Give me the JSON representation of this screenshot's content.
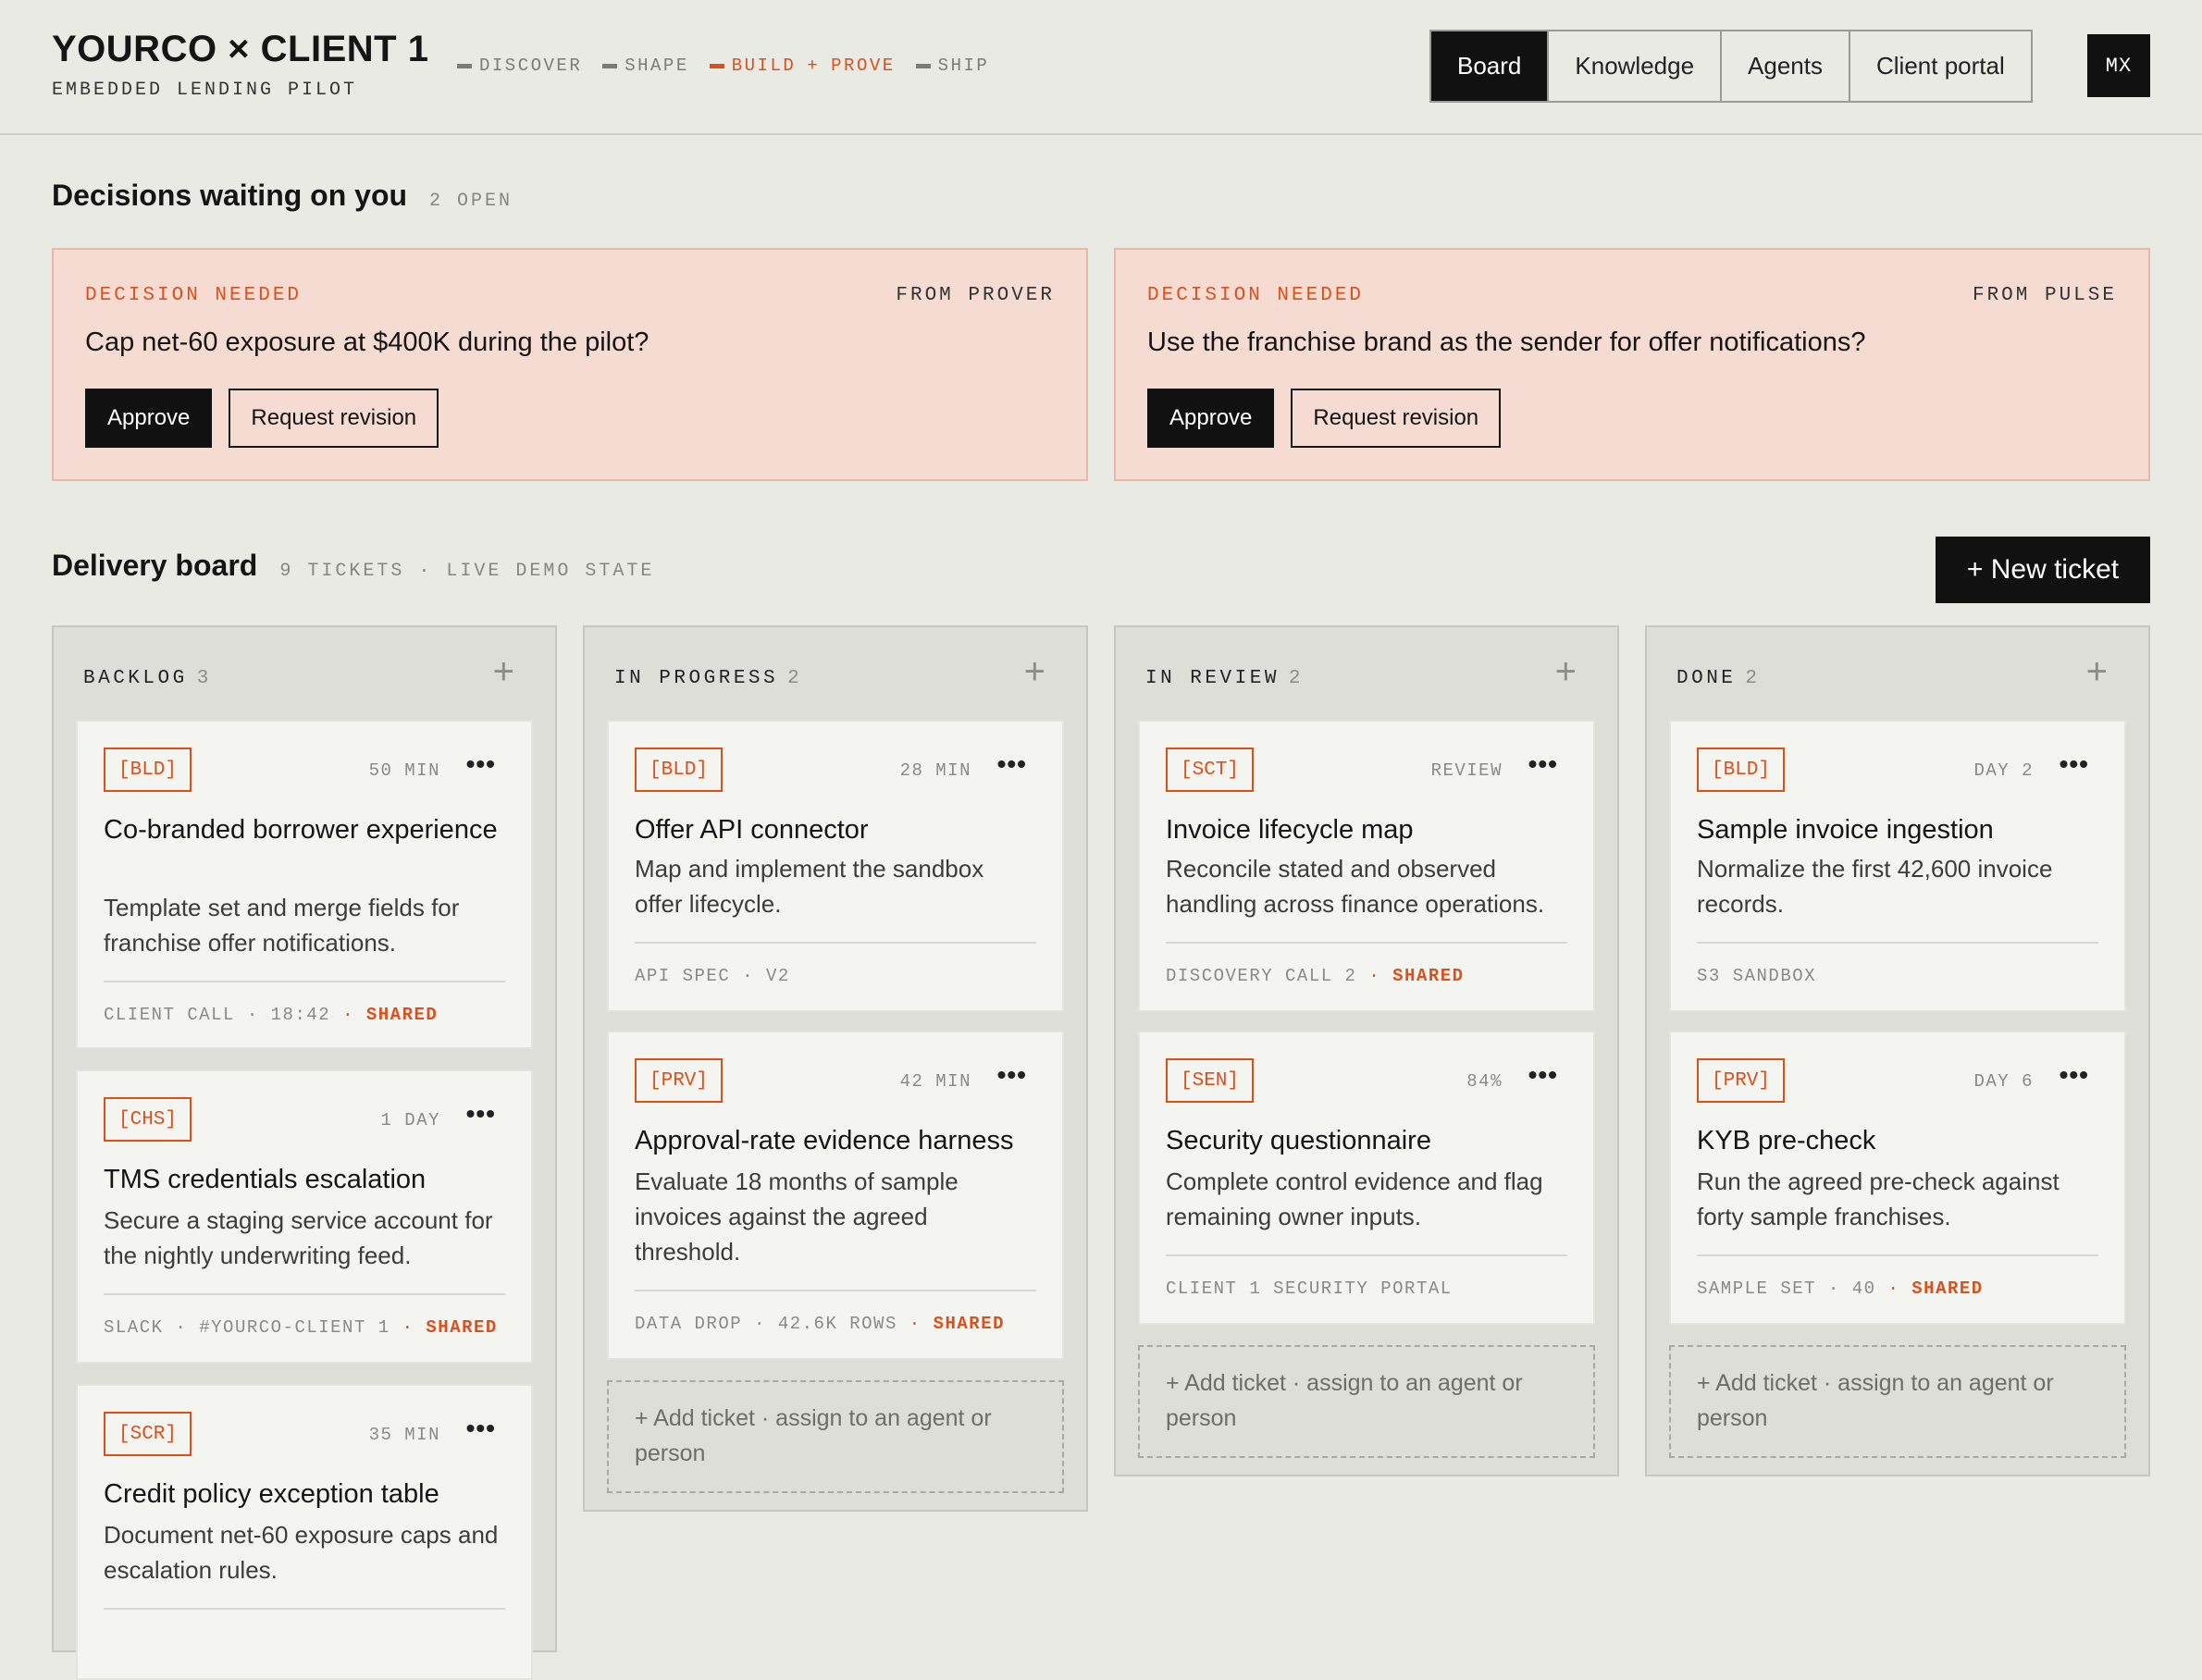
{
  "header": {
    "title": "YOURCO × CLIENT 1",
    "subtitle": "EMBEDDED LENDING PILOT",
    "phases": [
      {
        "label": "DISCOVER"
      },
      {
        "label": "SHAPE"
      },
      {
        "label_a": "BUILD",
        "plus": "+",
        "label_b": "PROVE",
        "active": true
      },
      {
        "label": "SHIP"
      }
    ],
    "tabs": [
      "Board",
      "Knowledge",
      "Agents",
      "Client portal"
    ],
    "active_tab": "Board",
    "avatar": "MX"
  },
  "decisions": {
    "title": "Decisions waiting on you",
    "meta": "2 OPEN",
    "items": [
      {
        "kind": "DECISION NEEDED",
        "from": "FROM PROVER",
        "question": "Cap net-60 exposure at $400K during the pilot?",
        "approve": "Approve",
        "revise": "Request revision"
      },
      {
        "kind": "DECISION NEEDED",
        "from": "FROM PULSE",
        "question": "Use the franchise brand as the sender for offer notifications?",
        "approve": "Approve",
        "revise": "Request revision"
      }
    ]
  },
  "board": {
    "title": "Delivery board",
    "meta": "9 TICKETS · LIVE DEMO STATE",
    "new_ticket": "+ New ticket",
    "add_ticket_text": "+ Add ticket · assign to an agent or person",
    "columns": [
      {
        "name": "BACKLOG",
        "count": "3",
        "cards": [
          {
            "tag": "[BLD]",
            "time": "50 MIN",
            "title": "Co-branded borrower experience",
            "desc": "Template set and merge fields for franchise offer notifications.",
            "foot_a": "CLIENT CALL",
            "foot_b": "18:42",
            "shared": "SHARED"
          },
          {
            "tag": "[CHS]",
            "time": "1 DAY",
            "title": "TMS credentials escalation",
            "desc": "Secure a staging service account for the nightly underwriting feed.",
            "foot_a": "SLACK",
            "foot_b": "#YOURCO-CLIENT 1",
            "shared": "SHARED"
          },
          {
            "tag": "[SCR]",
            "time": "35 MIN",
            "title": "Credit policy exception table",
            "desc": "Document net-60 exposure caps and escalation rules."
          }
        ]
      },
      {
        "name": "IN PROGRESS",
        "count": "2",
        "cards": [
          {
            "tag": "[BLD]",
            "time": "28 MIN",
            "title": "Offer API connector",
            "desc": "Map and implement the sandbox offer lifecycle.",
            "foot_a": "API SPEC",
            "foot_b": "V2"
          },
          {
            "tag": "[PRV]",
            "time": "42 MIN",
            "title": "Approval-rate evidence harness",
            "desc": "Evaluate 18 months of sample invoices against the agreed threshold.",
            "foot_a": "DATA DROP",
            "foot_b": "42.6K ROWS",
            "shared": "SHARED"
          }
        ]
      },
      {
        "name": "IN REVIEW",
        "count": "2",
        "cards": [
          {
            "tag": "[SCT]",
            "time": "REVIEW",
            "title": "Invoice lifecycle map",
            "desc": "Reconcile stated and observed handling across finance operations.",
            "foot_a": "DISCOVERY CALL 2",
            "shared": "SHARED"
          },
          {
            "tag": "[SEN]",
            "time": "84%",
            "title": "Security questionnaire",
            "desc": "Complete control evidence and flag remaining owner inputs.",
            "foot_a": "CLIENT 1 SECURITY PORTAL"
          }
        ]
      },
      {
        "name": "DONE",
        "count": "2",
        "cards": [
          {
            "tag": "[BLD]",
            "time": "DAY 2",
            "title": "Sample invoice ingestion",
            "desc": "Normalize the first 42,600 invoice records.",
            "foot_a": "S3 SANDBOX"
          },
          {
            "tag": "[PRV]",
            "time": "DAY 6",
            "title": "KYB pre-check",
            "desc": "Run the agreed pre-check against forty sample franchises.",
            "foot_a": "SAMPLE SET",
            "foot_b": "40",
            "shared": "SHARED"
          }
        ]
      }
    ]
  },
  "colors": {
    "accent": "#d9511c",
    "background": "#eaeae5",
    "decision_bg": "#f6dbd2",
    "dark": "#111111"
  }
}
